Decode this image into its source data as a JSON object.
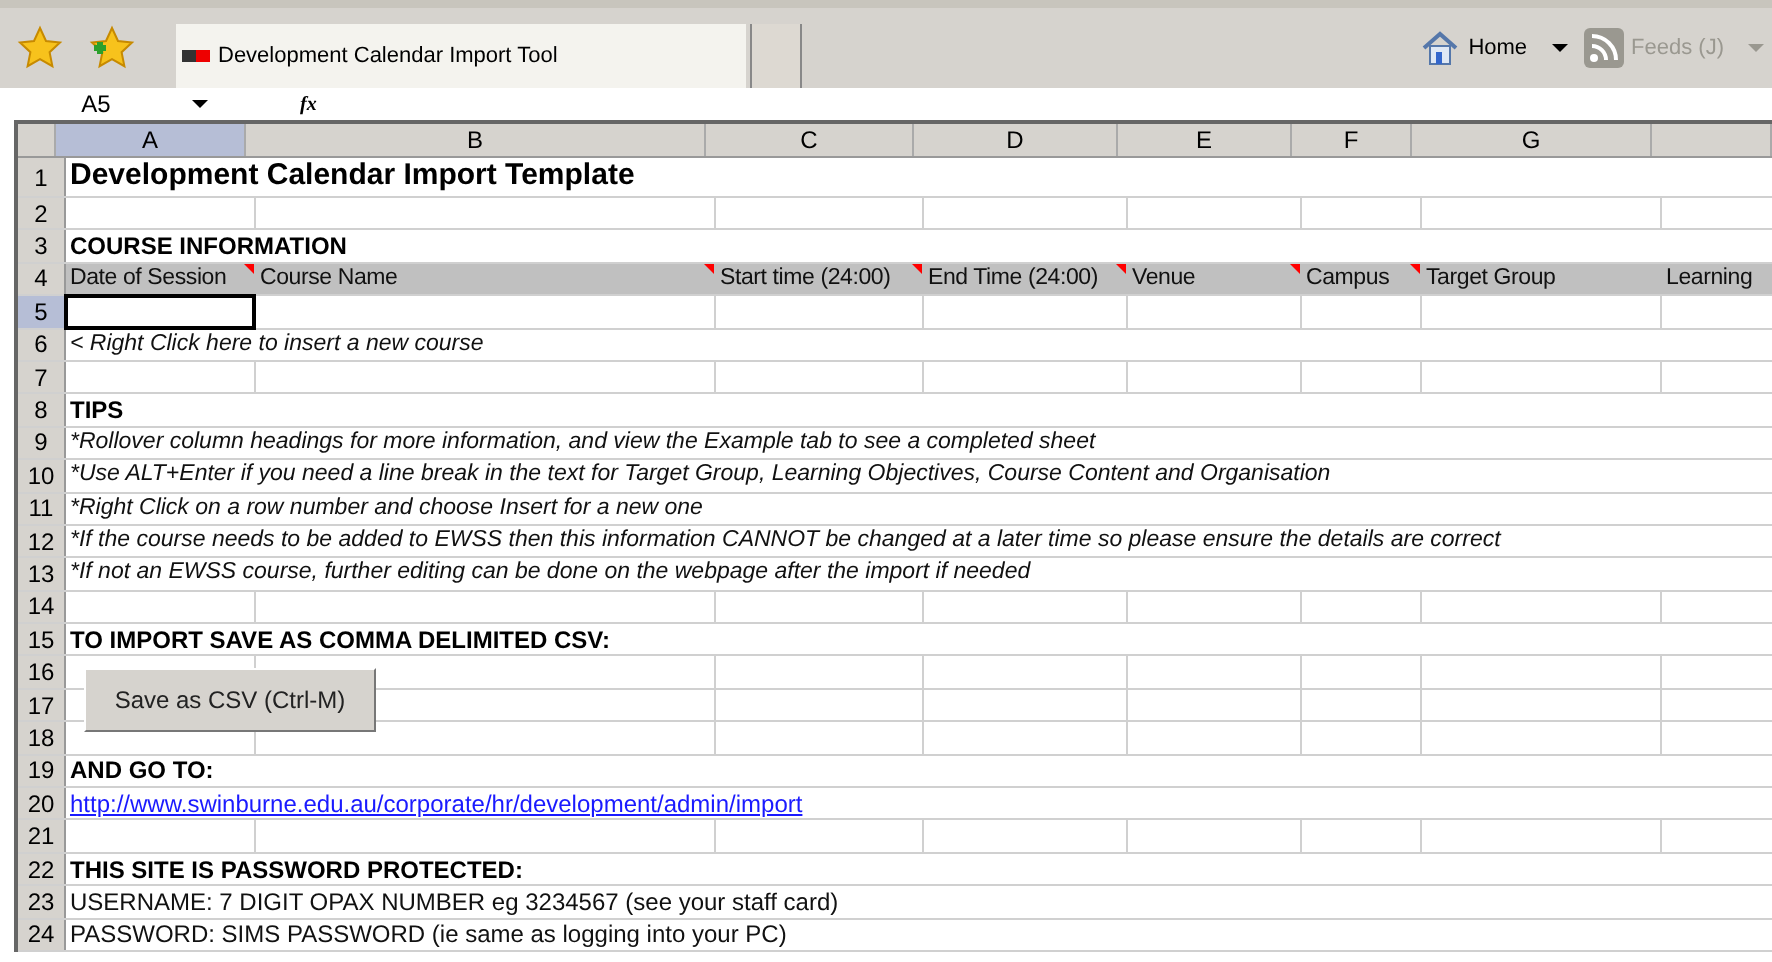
{
  "browser": {
    "tabs": [
      {
        "title": "Development Calendar Import Tool",
        "selected": true
      }
    ],
    "home": "Home",
    "feeds": {
      "label": "Feeds (J)",
      "disabled": true
    }
  },
  "formula_bar": {
    "name_box": "A5",
    "function_label": "fx"
  },
  "columns": [
    {
      "label": "A",
      "selected": true
    },
    {
      "label": "B",
      "selected": false
    },
    {
      "label": "C",
      "selected": false
    },
    {
      "label": "D",
      "selected": false
    },
    {
      "label": "E",
      "selected": false
    },
    {
      "label": "F",
      "selected": false
    },
    {
      "label": "G",
      "selected": false
    }
  ],
  "rows": [
    {
      "number": "1",
      "selected": false,
      "cells": [
        {
          "text": "Development Calendar Import Template",
          "kind": "title"
        }
      ]
    },
    {
      "number": "2",
      "selected": false
    },
    {
      "number": "3",
      "selected": false,
      "cells": [
        {
          "text": "COURSE INFORMATION",
          "kind": "heading"
        }
      ]
    },
    {
      "number": "4",
      "selected": false,
      "cells": [
        {
          "text": "Date of Session",
          "kind": "header",
          "comment": true
        },
        {
          "text": "Course Name",
          "kind": "header",
          "comment": true
        },
        {
          "text": "Start time (24:00)",
          "kind": "header",
          "comment": true
        },
        {
          "text": "End Time (24:00)",
          "kind": "header",
          "comment": true
        },
        {
          "text": "Venue",
          "kind": "header",
          "comment": true
        },
        {
          "text": "Campus",
          "kind": "header",
          "comment": true
        },
        {
          "text": "Target Group",
          "kind": "header"
        },
        {
          "text": "Learning",
          "kind": "header"
        }
      ]
    },
    {
      "number": "5",
      "selected": true
    },
    {
      "number": "6",
      "selected": false,
      "cells": [
        {
          "text": "< Right Click here to insert a new course",
          "kind": "note"
        }
      ]
    },
    {
      "number": "7",
      "selected": false
    },
    {
      "number": "8",
      "selected": false,
      "cells": [
        {
          "text": "TIPS",
          "kind": "heading"
        }
      ]
    },
    {
      "number": "9",
      "selected": false,
      "cells": [
        {
          "text": "*Rollover column headings for more information, and view the Example tab to see a completed sheet",
          "kind": "note"
        }
      ]
    },
    {
      "number": "10",
      "selected": false,
      "cells": [
        {
          "text": "*Use ALT+Enter if you need a line break in the text for Target Group, Learning Objectives, Course Content and Organisation",
          "kind": "note"
        }
      ]
    },
    {
      "number": "11",
      "selected": false,
      "cells": [
        {
          "text": "*Right Click on a row number and choose Insert for a new one",
          "kind": "note"
        }
      ]
    },
    {
      "number": "12",
      "selected": false,
      "cells": [
        {
          "text": "*If the course needs to be added to EWSS then this information CANNOT be changed at a later time so please ensure the details are correct",
          "kind": "note"
        }
      ]
    },
    {
      "number": "13",
      "selected": false,
      "cells": [
        {
          "text": "*If not an EWSS course, further editing can be done on the webpage after the import if needed",
          "kind": "note"
        }
      ]
    },
    {
      "number": "14",
      "selected": false
    },
    {
      "number": "15",
      "selected": false,
      "cells": [
        {
          "text": "TO IMPORT SAVE AS COMMA DELIMITED CSV:",
          "kind": "heading"
        }
      ]
    },
    {
      "number": "16",
      "selected": false
    },
    {
      "number": "17",
      "selected": false
    },
    {
      "number": "18",
      "selected": false
    },
    {
      "number": "19",
      "selected": false,
      "cells": [
        {
          "text": "AND GO TO:",
          "kind": "heading"
        }
      ]
    },
    {
      "number": "20",
      "selected": false,
      "cells": [
        {
          "text": "http://www.swinburne.edu.au/corporate/hr/development/admin/import",
          "kind": "link"
        }
      ]
    },
    {
      "number": "21",
      "selected": false
    },
    {
      "number": "22",
      "selected": false,
      "cells": [
        {
          "text": "THIS SITE IS PASSWORD PROTECTED:",
          "kind": "heading"
        }
      ]
    },
    {
      "number": "23",
      "selected": false,
      "cells": [
        {
          "text": "USERNAME: 7 DIGIT OPAX NUMBER eg 3234567 (see your staff card)",
          "kind": "text"
        }
      ]
    },
    {
      "number": "24",
      "selected": false,
      "cells": [
        {
          "text": "PASSWORD: SIMS PASSWORD (ie same as logging into your PC)",
          "kind": "text"
        }
      ]
    }
  ],
  "save_button": {
    "label": "Save as CSV (Ctrl-M)"
  }
}
